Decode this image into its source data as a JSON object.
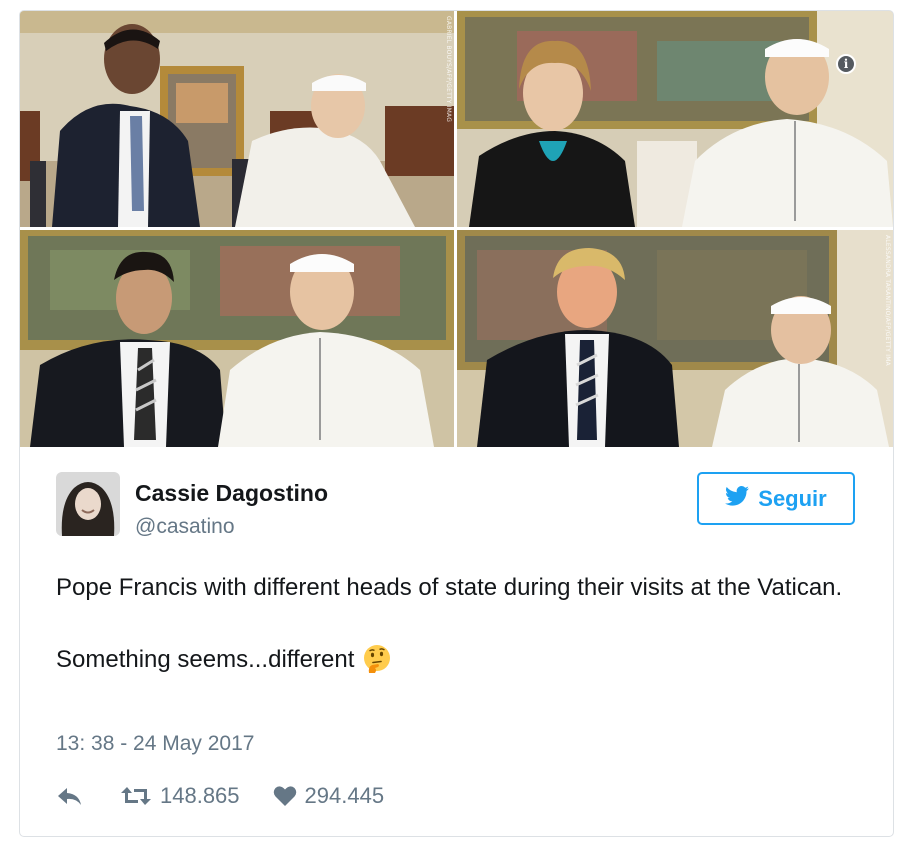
{
  "tweet": {
    "author_name": "Cassie Dagostino",
    "author_handle": "@casatino",
    "follow_label": "Seguir",
    "text_paragraph_1": "Pope Francis with different heads of state during their visits at the Vatican.",
    "text_paragraph_2": "Something seems...different",
    "emoji": "thinking-face",
    "timestamp": "13: 38 - 24 May 2017",
    "retweet_count": "148.865",
    "like_count": "294.445"
  },
  "media": {
    "credit_top_left": "GABRIEL BOUYS/AFP/GETTY IMAG",
    "credit_bottom_right": "ALESSANDRA TARANTINO/AFP/GETTY IMA",
    "info_symbol": "i"
  },
  "icons": {
    "reply": "reply-icon",
    "retweet": "retweet-icon",
    "like": "heart-icon",
    "follow": "twitter-bird-icon",
    "info": "info-icon"
  },
  "colors": {
    "accent": "#1da1f2",
    "secondary_text": "#657786",
    "primary_text": "#14171a",
    "border": "#dde1e5"
  }
}
